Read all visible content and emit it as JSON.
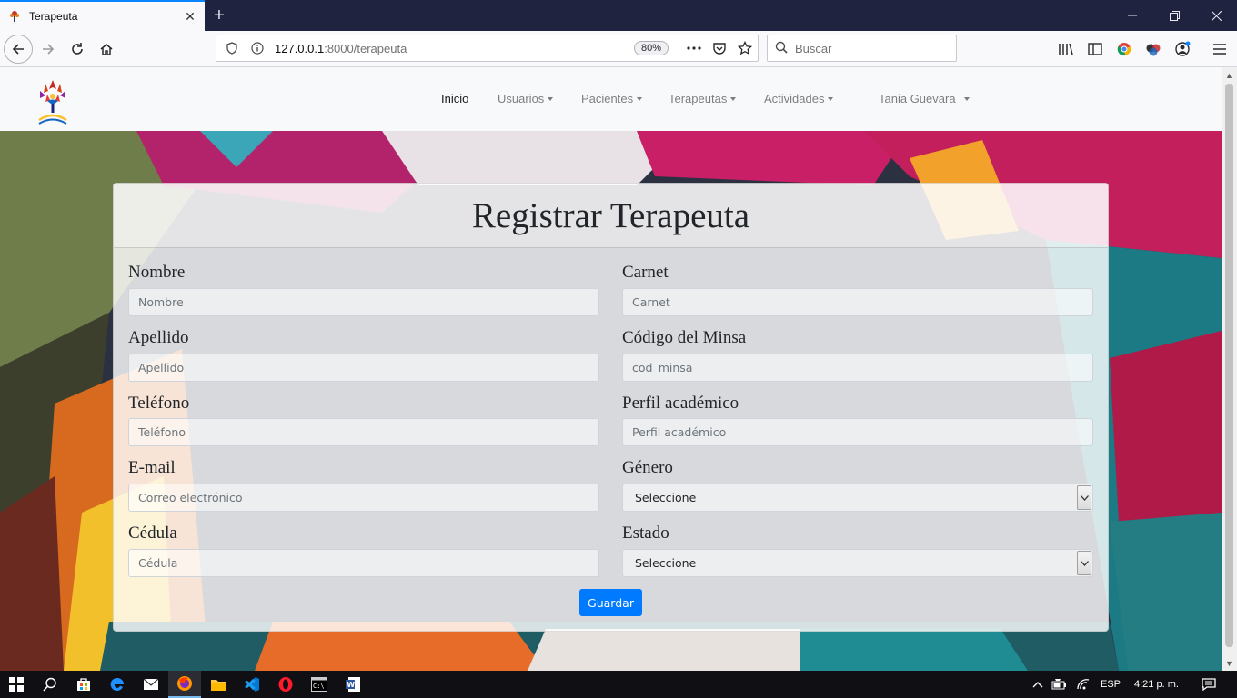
{
  "browser": {
    "tab_title": "Terapeuta",
    "url_host": "127.0.0.1",
    "url_path": ":8000/terapeuta",
    "zoom": "80%",
    "search_placeholder": "Buscar"
  },
  "site": {
    "nav": {
      "items": [
        {
          "label": "Inicio",
          "dropdown": false,
          "active": true
        },
        {
          "label": "Usuarios",
          "dropdown": true
        },
        {
          "label": "Pacientes",
          "dropdown": true
        },
        {
          "label": "Terapeutas",
          "dropdown": true
        },
        {
          "label": "Actividades",
          "dropdown": true
        },
        {
          "label": "Tania Guevara",
          "dropdown": true
        }
      ]
    },
    "form": {
      "title": "Registrar Terapeuta",
      "fields": {
        "nombre": {
          "label": "Nombre",
          "placeholder": "Nombre"
        },
        "carnet": {
          "label": "Carnet",
          "placeholder": "Carnet"
        },
        "apellido": {
          "label": "Apellido",
          "placeholder": "Apellido"
        },
        "codigo_minsa": {
          "label": "Código del Minsa",
          "placeholder": "cod_minsa"
        },
        "telefono": {
          "label": "Teléfono",
          "placeholder": "Teléfono"
        },
        "perfil": {
          "label": "Perfil académico",
          "placeholder": "Perfil académico"
        },
        "email": {
          "label": "E-mail",
          "placeholder": "Correo electrónico"
        },
        "genero": {
          "label": "Género",
          "value": "Seleccione"
        },
        "cedula": {
          "label": "Cédula",
          "placeholder": "Cédula"
        },
        "estado": {
          "label": "Estado",
          "value": "Seleccione"
        }
      },
      "submit_label": "Guardar"
    }
  },
  "taskbar": {
    "language": "ESP",
    "time": "4:21 p. m."
  },
  "colors": {
    "primary": "#007bff",
    "tab_accent": "#0a84ff",
    "chrome_dark": "#202340"
  }
}
